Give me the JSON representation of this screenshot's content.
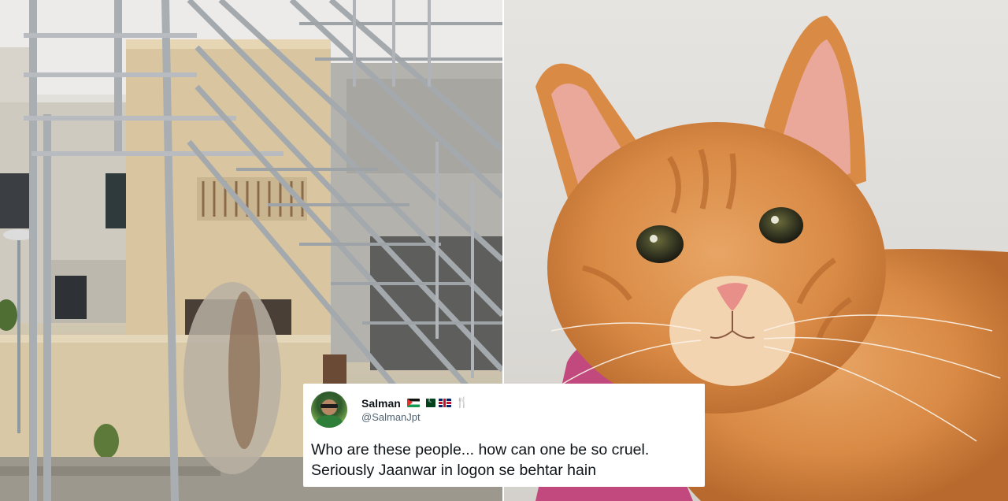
{
  "tweet": {
    "display_name": "Salman",
    "handle": "@SalmanJpt",
    "badges": [
      "palestine-flag",
      "pakistan-flag",
      "uk-flag",
      "fork-knife-icon"
    ],
    "text_line1": "Who are these people... how can one be so cruel.",
    "text_line2": "Seriously Jaanwar in logon se behtar hain"
  },
  "colors": {
    "tweet_background": "#ffffff",
    "name": "#0f1419",
    "handle": "#536471",
    "cat_fur": "#d98a45"
  }
}
